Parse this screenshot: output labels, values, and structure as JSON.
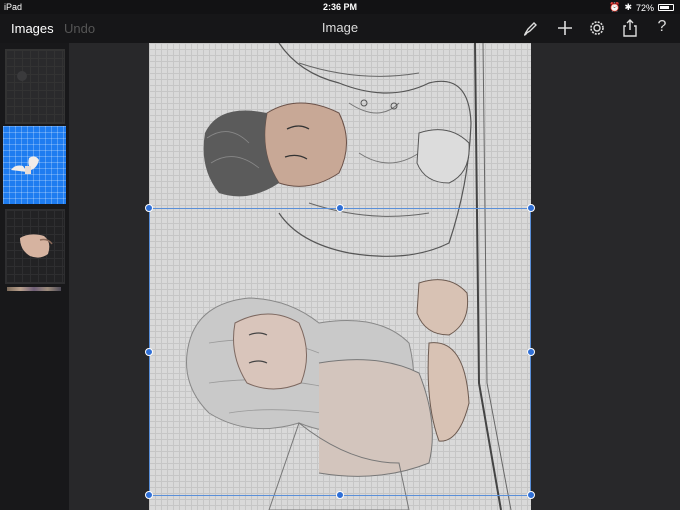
{
  "status_bar": {
    "device": "iPad",
    "time": "2:36 PM",
    "battery": "72%",
    "battery_level": 0.72
  },
  "toolbar": {
    "images_label": "Images",
    "undo_label": "Undo",
    "title": "Image",
    "icons": [
      "brush-icon",
      "add-icon",
      "settings-gear-icon",
      "share-icon",
      "help-icon"
    ],
    "help_glyph": "?"
  },
  "sidebar": {
    "thumbnails": [
      "layer-thumbnail-1",
      "layer-thumbnail-2",
      "layer-thumbnail-3"
    ],
    "selected": 1
  },
  "colors": {
    "accent": "#1e7cf0",
    "selection": "#2f6fd6"
  }
}
